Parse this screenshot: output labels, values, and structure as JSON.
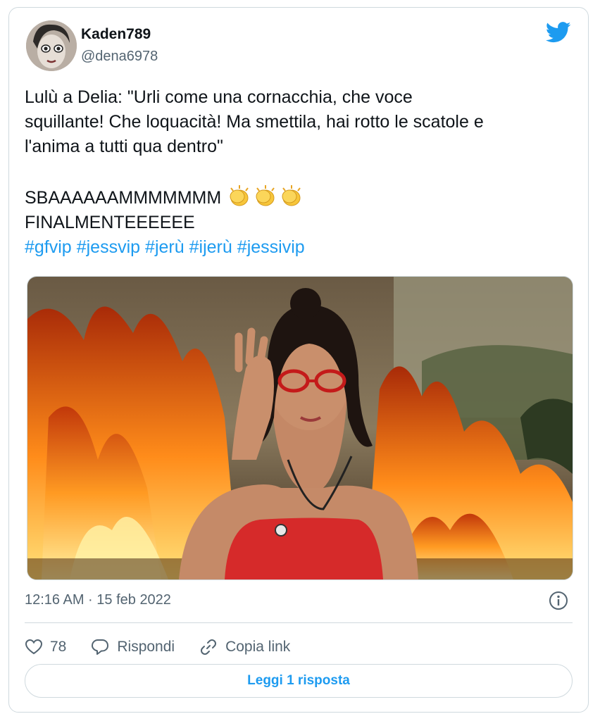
{
  "author": {
    "display_name": "Kaden789",
    "handle": "@dena6978"
  },
  "tweet": {
    "lines": [
      "Lulù a Delia: \"Urli come una cornacchia, che voce",
      "squillante! Che loquacità! Ma smettila, hai rotto le scatole e",
      "l'anima a tutti qua dentro\""
    ],
    "shout_line_1": "SBAAAAAAMMMMMMM",
    "shout_line_2": "FINALMENTEEEEEE",
    "hashtags": [
      "#gfvip",
      "#jessvip",
      "#jerù",
      "#ijerù",
      "#jessivip"
    ]
  },
  "meta": {
    "timestamp": "12:16 AM · 15 feb 2022"
  },
  "actions": {
    "likes": "78",
    "reply_label": "Rispondi",
    "copy_link_label": "Copia link"
  },
  "read_reply_label": "Leggi 1 risposta",
  "colors": {
    "accent": "#1d9bf0",
    "text": "#0f1419",
    "secondary": "#536471",
    "border": "#cfd9de"
  },
  "icons": [
    "twitter-bird-icon",
    "clapping-hands-icon",
    "info-icon",
    "heart-icon",
    "reply-bubble-icon",
    "link-icon"
  ]
}
